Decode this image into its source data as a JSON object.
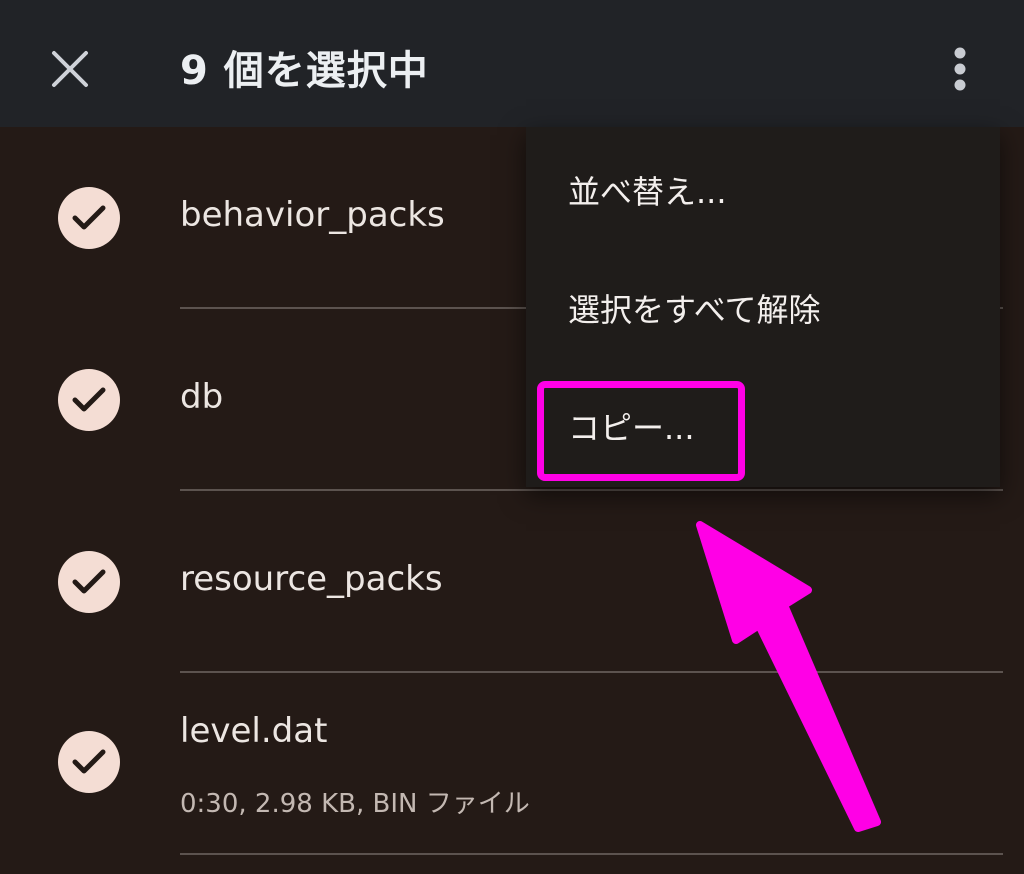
{
  "app_bar": {
    "close_icon": "close-icon",
    "title": "9 個を選択中",
    "overflow_icon": "more-vert-icon"
  },
  "files": [
    {
      "name": "behavior_packs",
      "meta": "",
      "selected": true
    },
    {
      "name": "db",
      "meta": "",
      "selected": true
    },
    {
      "name": "resource_packs",
      "meta": "",
      "selected": true
    },
    {
      "name": "level.dat",
      "meta": "0:30, 2.98 KB, BIN ファイル",
      "selected": true
    }
  ],
  "menu": {
    "items": [
      {
        "label": "並べ替え..."
      },
      {
        "label": "選択をすべて解除"
      },
      {
        "label": "コピー..."
      }
    ]
  },
  "annotation": {
    "highlight_color": "#ff00e6",
    "target": "コピー..."
  },
  "colors": {
    "background": "#241a16",
    "app_bar": "#212327",
    "check_circle": "#f4ddd4",
    "menu_bg": "#1f1c1a"
  }
}
